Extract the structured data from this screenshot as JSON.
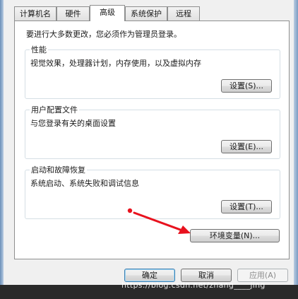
{
  "tabs": [
    {
      "label": "计算机名"
    },
    {
      "label": "硬件"
    },
    {
      "label": "高级"
    },
    {
      "label": "系统保护"
    },
    {
      "label": "远程"
    }
  ],
  "notice": "要进行大多数更改，您必须作为管理员登录。",
  "groups": [
    {
      "title": "性能",
      "description": "视觉效果，处理器计划，内存使用，以及虚拟内存",
      "button": "设置(S)..."
    },
    {
      "title": "用户配置文件",
      "description": "与您登录有关的桌面设置",
      "button": "设置(E)..."
    },
    {
      "title": "启动和故障恢复",
      "description": "系统启动、系统失败和调试信息",
      "button": "设置(T)..."
    }
  ],
  "env_button": "环境变量(N)...",
  "footer": {
    "ok": "确定",
    "cancel": "取消",
    "apply": "应用(A)"
  },
  "watermark": "https://blog.csdn.net/zhang____jing",
  "colors": {
    "annotation_arrow": "#e8121e",
    "focus_border": "#3c7fb1"
  }
}
